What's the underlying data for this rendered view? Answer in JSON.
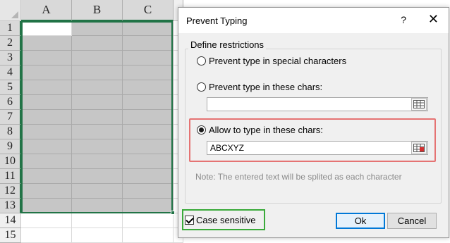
{
  "spreadsheet": {
    "columns": [
      "A",
      "B",
      "C"
    ],
    "rows": [
      "1",
      "2",
      "3",
      "4",
      "5",
      "6",
      "7",
      "8",
      "9",
      "10",
      "11",
      "12",
      "13",
      "14",
      "15"
    ]
  },
  "dialog": {
    "title": "Prevent Typing",
    "help_label": "?",
    "close_label": "✕",
    "group_label": "Define restrictions",
    "options": [
      {
        "label": "Prevent type in special characters",
        "checked": false
      },
      {
        "label": "Prevent type in these chars:",
        "checked": false,
        "value": ""
      },
      {
        "label": "Allow to type in these chars:",
        "checked": true,
        "value": "ABCXYZ"
      }
    ],
    "note": "Note: The entered text will be splited as each character",
    "case_sensitive": {
      "label": "Case sensitive",
      "checked": true
    },
    "ok_label": "Ok",
    "cancel_label": "Cancel"
  },
  "colors": {
    "selection_border": "#217346",
    "highlight_red": "#e57373",
    "highlight_green": "#3aaa3a",
    "selected_cell_fill": "#c6c6c6"
  }
}
